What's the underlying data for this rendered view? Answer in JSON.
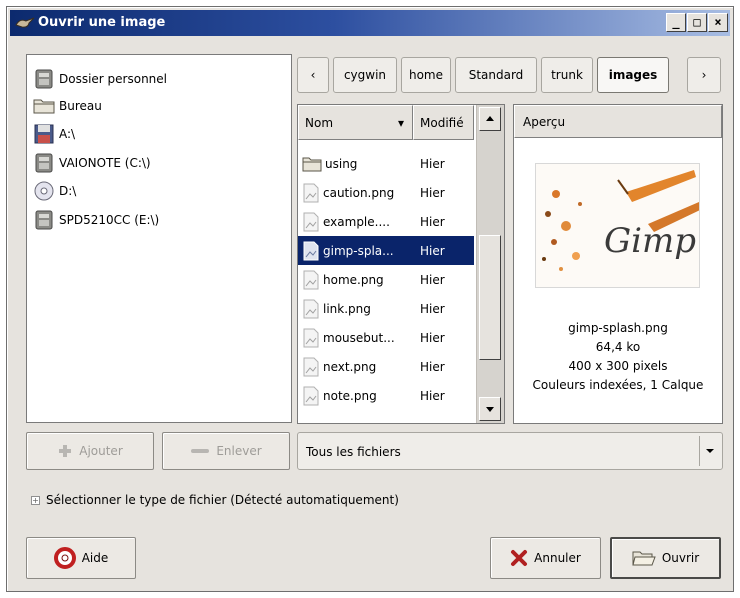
{
  "window": {
    "title": "Ouvrir une image",
    "minimize": "_",
    "maximize": "□",
    "close": "×"
  },
  "places": [
    {
      "label": "Dossier personnel",
      "icon": "home-icon"
    },
    {
      "label": "Bureau",
      "icon": "folder-icon"
    },
    {
      "label": "A:\\",
      "icon": "floppy-icon"
    },
    {
      "label": "VAIONOTE (C:\\)",
      "icon": "harddisk-icon"
    },
    {
      "label": "D:\\",
      "icon": "cdrom-icon"
    },
    {
      "label": "SPD5210CC (E:\\)",
      "icon": "harddisk-icon"
    }
  ],
  "pathbar": {
    "back": "‹",
    "forward": "›",
    "segments": [
      "cygwin",
      "home",
      "Standard",
      "trunk",
      "images"
    ],
    "active_segment": "images"
  },
  "filelist": {
    "col_name": "Nom",
    "col_modified": "Modifié",
    "sort_indicator": "▾",
    "rows": [
      {
        "name": "using",
        "modified": "Hier",
        "type": "folder"
      },
      {
        "name": "caution.png",
        "modified": "Hier",
        "type": "image"
      },
      {
        "name": "example....",
        "modified": "Hier",
        "type": "image"
      },
      {
        "name": "gimp-spla...",
        "modified": "Hier",
        "type": "image",
        "selected": true
      },
      {
        "name": "home.png",
        "modified": "Hier",
        "type": "image"
      },
      {
        "name": "link.png",
        "modified": "Hier",
        "type": "image"
      },
      {
        "name": "mousebut...",
        "modified": "Hier",
        "type": "image"
      },
      {
        "name": "next.png",
        "modified": "Hier",
        "type": "image"
      },
      {
        "name": "note.png",
        "modified": "Hier",
        "type": "image"
      }
    ]
  },
  "preview": {
    "header": "Aperçu",
    "logo_text": "Gimp",
    "filename": "gimp-splash.png",
    "size": "64,4 ko",
    "dimensions": "400 x 300 pixels",
    "details": "Couleurs indexées, 1 Calque"
  },
  "buttons": {
    "add": "Ajouter",
    "remove": "Enlever",
    "help": "Aide",
    "cancel": "Annuler",
    "open": "Ouvrir"
  },
  "filter": {
    "selected": "Tous les fichiers"
  },
  "expander": {
    "label": "Sélectionner le type de fichier (Détecté automatiquement)",
    "symbol": "+"
  },
  "colors": {
    "selection": "#0a246a",
    "titlebar_start": "#0c2a6e",
    "titlebar_end": "#a8bde3",
    "dialog_bg": "#e6e3de"
  }
}
